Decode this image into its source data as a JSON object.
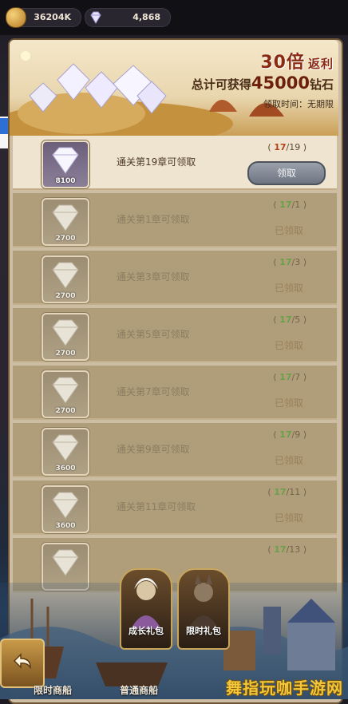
{
  "resources": {
    "gold": "36204K",
    "diamonds": "4,868"
  },
  "banner": {
    "multiplier_prefix": "30倍",
    "multiplier_suffix": "返利",
    "total_prefix": "总计可获得",
    "total_amount": "45000",
    "total_suffix": "钻石",
    "time_label": "领取时间：无期限"
  },
  "rewards": [
    {
      "title": "通关第19章可领取",
      "qty": "8100",
      "current": "17",
      "required": "/19",
      "state": "claimable",
      "action": "领取"
    },
    {
      "title": "通关第1章可领取",
      "qty": "2700",
      "current": "17",
      "required": "/1",
      "state": "claimed",
      "action": "已领取"
    },
    {
      "title": "通关第3章可领取",
      "qty": "2700",
      "current": "17",
      "required": "/3",
      "state": "claimed",
      "action": "已领取"
    },
    {
      "title": "通关第5章可领取",
      "qty": "2700",
      "current": "17",
      "required": "/5",
      "state": "claimed",
      "action": "已领取"
    },
    {
      "title": "通关第7章可领取",
      "qty": "2700",
      "current": "17",
      "required": "/7",
      "state": "claimed",
      "action": "已领取"
    },
    {
      "title": "通关第9章可领取",
      "qty": "3600",
      "current": "17",
      "required": "/9",
      "state": "claimed",
      "action": "已领取"
    },
    {
      "title": "通关第11章可领取",
      "qty": "3600",
      "current": "17",
      "required": "/11",
      "state": "claimed",
      "action": "已领取"
    },
    {
      "title": "",
      "qty": "",
      "current": "17",
      "required": "/13",
      "state": "claimed",
      "action": ""
    }
  ],
  "gifts": [
    {
      "label": "成长礼包"
    },
    {
      "label": "限时礼包"
    }
  ],
  "nav": {
    "item1": "限时商船",
    "item2": "普通商船"
  },
  "watermark": "舞指玩咖手游网",
  "colors": {
    "accent_red": "#b3431b",
    "progress_green": "#4d9a2f",
    "panel_bg": "#efe4cf"
  }
}
